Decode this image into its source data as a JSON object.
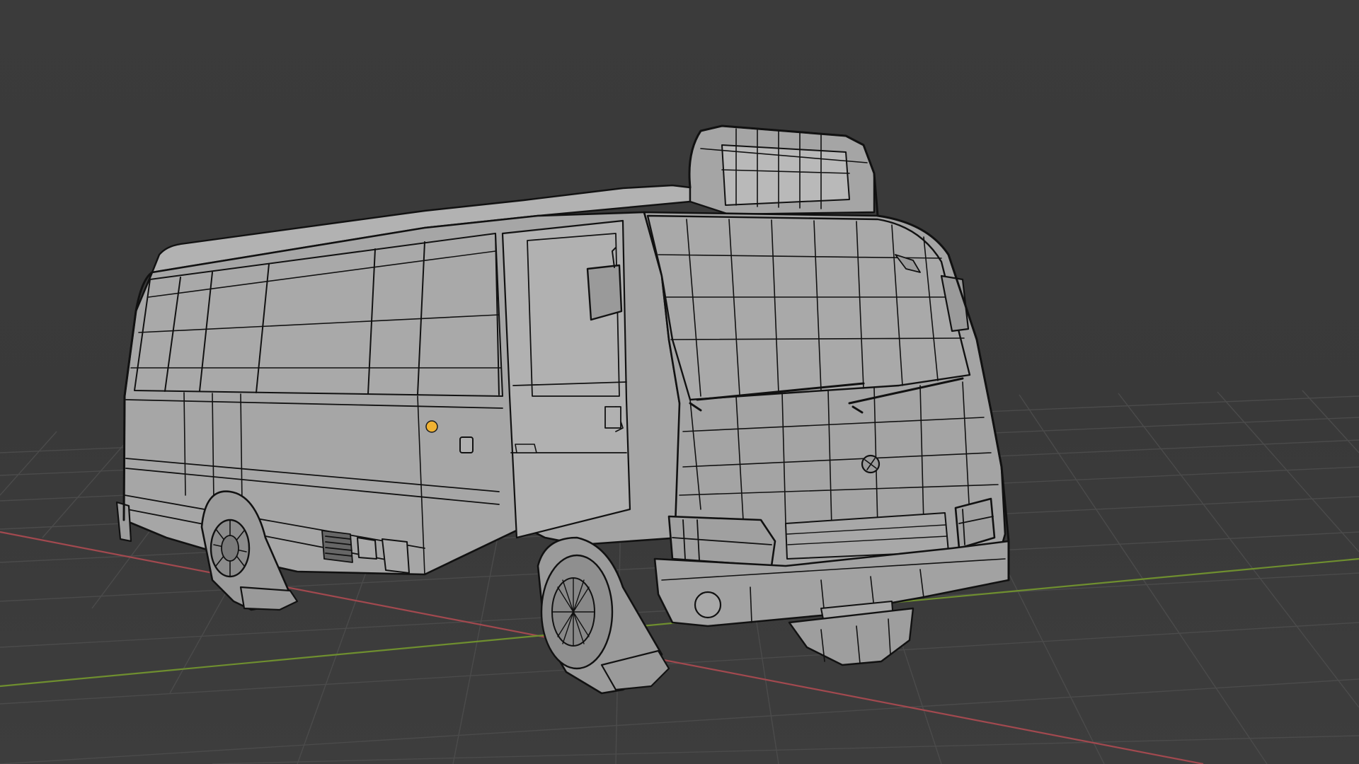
{
  "viewport": {
    "kind": "3d-viewport",
    "shading": "solid",
    "overlay": "wireframe",
    "object": "minibus-mesh",
    "object_color": "#9d9d9d",
    "edge_color": "#111111",
    "background_color": "#3a3a3a",
    "grid_color": "#4a4a4a",
    "x_axis_color": "#a2494f",
    "y_axis_color": "#6f8f2f",
    "origin_color": "#f0b232"
  }
}
